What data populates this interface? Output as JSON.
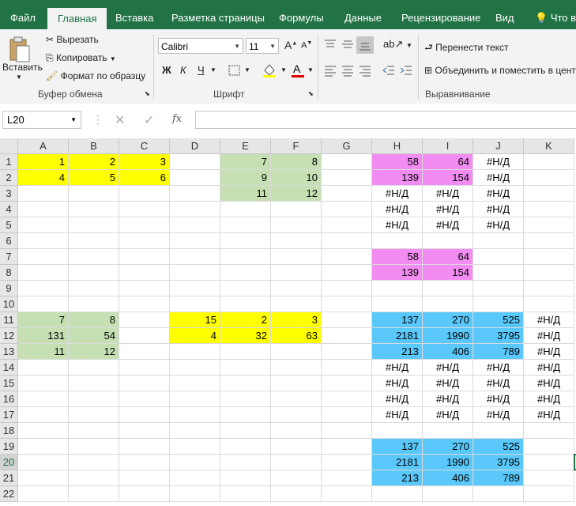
{
  "tabs": [
    "Файл",
    "Главная",
    "Вставка",
    "Разметка страницы",
    "Формулы",
    "Данные",
    "Рецензирование",
    "Вид",
    "Что вы"
  ],
  "ribbon": {
    "paste": "Вставить",
    "cut": "Вырезать",
    "copy": "Копировать",
    "format_painter": "Формат по образцу",
    "clipboard_group": "Буфер обмена",
    "font_name": "Calibri",
    "font_size": "11",
    "bold": "Ж",
    "italic": "К",
    "underline": "Ч",
    "font_group": "Шрифт",
    "wrap_text": "Перенести текст",
    "merge": "Объединить и поместить в центре",
    "align_group": "Выравнивание"
  },
  "formula_bar": {
    "name_box": "L20",
    "fx": "fx",
    "value": ""
  },
  "columns": [
    "A",
    "B",
    "C",
    "D",
    "E",
    "F",
    "G",
    "H",
    "I",
    "J",
    "K"
  ],
  "rows": [
    "1",
    "2",
    "3",
    "4",
    "5",
    "6",
    "7",
    "8",
    "9",
    "10",
    "11",
    "12",
    "13",
    "14",
    "15",
    "16",
    "17",
    "18",
    "19",
    "20",
    "21",
    "22"
  ],
  "cells": [
    {
      "c": "A",
      "r": 1,
      "v": "1",
      "f": "y"
    },
    {
      "c": "B",
      "r": 1,
      "v": "2",
      "f": "y"
    },
    {
      "c": "C",
      "r": 1,
      "v": "3",
      "f": "y"
    },
    {
      "c": "A",
      "r": 2,
      "v": "4",
      "f": "y"
    },
    {
      "c": "B",
      "r": 2,
      "v": "5",
      "f": "y"
    },
    {
      "c": "C",
      "r": 2,
      "v": "6",
      "f": "y"
    },
    {
      "c": "E",
      "r": 1,
      "v": "7",
      "f": "g"
    },
    {
      "c": "F",
      "r": 1,
      "v": "8",
      "f": "g"
    },
    {
      "c": "E",
      "r": 2,
      "v": "9",
      "f": "g"
    },
    {
      "c": "F",
      "r": 2,
      "v": "10",
      "f": "g"
    },
    {
      "c": "E",
      "r": 3,
      "v": "11",
      "f": "g"
    },
    {
      "c": "F",
      "r": 3,
      "v": "12",
      "f": "g"
    },
    {
      "c": "H",
      "r": 1,
      "v": "58",
      "f": "p"
    },
    {
      "c": "I",
      "r": 1,
      "v": "64",
      "f": "p"
    },
    {
      "c": "J",
      "r": 1,
      "v": "#Н/Д",
      "a": "ctr"
    },
    {
      "c": "H",
      "r": 2,
      "v": "139",
      "f": "p"
    },
    {
      "c": "I",
      "r": 2,
      "v": "154",
      "f": "p"
    },
    {
      "c": "J",
      "r": 2,
      "v": "#Н/Д",
      "a": "ctr"
    },
    {
      "c": "H",
      "r": 3,
      "v": "#Н/Д",
      "a": "ctr"
    },
    {
      "c": "I",
      "r": 3,
      "v": "#Н/Д",
      "a": "ctr"
    },
    {
      "c": "J",
      "r": 3,
      "v": "#Н/Д",
      "a": "ctr"
    },
    {
      "c": "H",
      "r": 4,
      "v": "#Н/Д",
      "a": "ctr"
    },
    {
      "c": "I",
      "r": 4,
      "v": "#Н/Д",
      "a": "ctr"
    },
    {
      "c": "J",
      "r": 4,
      "v": "#Н/Д",
      "a": "ctr"
    },
    {
      "c": "H",
      "r": 5,
      "v": "#Н/Д",
      "a": "ctr"
    },
    {
      "c": "I",
      "r": 5,
      "v": "#Н/Д",
      "a": "ctr"
    },
    {
      "c": "J",
      "r": 5,
      "v": "#Н/Д",
      "a": "ctr"
    },
    {
      "c": "H",
      "r": 7,
      "v": "58",
      "f": "p"
    },
    {
      "c": "I",
      "r": 7,
      "v": "64",
      "f": "p"
    },
    {
      "c": "H",
      "r": 8,
      "v": "139",
      "f": "p"
    },
    {
      "c": "I",
      "r": 8,
      "v": "154",
      "f": "p"
    },
    {
      "c": "A",
      "r": 11,
      "v": "7",
      "f": "g"
    },
    {
      "c": "B",
      "r": 11,
      "v": "8",
      "f": "g"
    },
    {
      "c": "A",
      "r": 12,
      "v": "131",
      "f": "g"
    },
    {
      "c": "B",
      "r": 12,
      "v": "54",
      "f": "g"
    },
    {
      "c": "A",
      "r": 13,
      "v": "11",
      "f": "g"
    },
    {
      "c": "B",
      "r": 13,
      "v": "12",
      "f": "g"
    },
    {
      "c": "D",
      "r": 11,
      "v": "15",
      "f": "y"
    },
    {
      "c": "E",
      "r": 11,
      "v": "2",
      "f": "y"
    },
    {
      "c": "F",
      "r": 11,
      "v": "3",
      "f": "y"
    },
    {
      "c": "D",
      "r": 12,
      "v": "4",
      "f": "y"
    },
    {
      "c": "E",
      "r": 12,
      "v": "32",
      "f": "y"
    },
    {
      "c": "F",
      "r": 12,
      "v": "63",
      "f": "y"
    },
    {
      "c": "H",
      "r": 11,
      "v": "137",
      "f": "b"
    },
    {
      "c": "I",
      "r": 11,
      "v": "270",
      "f": "b"
    },
    {
      "c": "J",
      "r": 11,
      "v": "525",
      "f": "b"
    },
    {
      "c": "K",
      "r": 11,
      "v": "#Н/Д",
      "a": "ctr"
    },
    {
      "c": "H",
      "r": 12,
      "v": "2181",
      "f": "b"
    },
    {
      "c": "I",
      "r": 12,
      "v": "1990",
      "f": "b"
    },
    {
      "c": "J",
      "r": 12,
      "v": "3795",
      "f": "b"
    },
    {
      "c": "K",
      "r": 12,
      "v": "#Н/Д",
      "a": "ctr"
    },
    {
      "c": "H",
      "r": 13,
      "v": "213",
      "f": "b"
    },
    {
      "c": "I",
      "r": 13,
      "v": "406",
      "f": "b"
    },
    {
      "c": "J",
      "r": 13,
      "v": "789",
      "f": "b"
    },
    {
      "c": "K",
      "r": 13,
      "v": "#Н/Д",
      "a": "ctr"
    },
    {
      "c": "H",
      "r": 14,
      "v": "#Н/Д",
      "a": "ctr"
    },
    {
      "c": "I",
      "r": 14,
      "v": "#Н/Д",
      "a": "ctr"
    },
    {
      "c": "J",
      "r": 14,
      "v": "#Н/Д",
      "a": "ctr"
    },
    {
      "c": "K",
      "r": 14,
      "v": "#Н/Д",
      "a": "ctr"
    },
    {
      "c": "H",
      "r": 15,
      "v": "#Н/Д",
      "a": "ctr"
    },
    {
      "c": "I",
      "r": 15,
      "v": "#Н/Д",
      "a": "ctr"
    },
    {
      "c": "J",
      "r": 15,
      "v": "#Н/Д",
      "a": "ctr"
    },
    {
      "c": "K",
      "r": 15,
      "v": "#Н/Д",
      "a": "ctr"
    },
    {
      "c": "H",
      "r": 16,
      "v": "#Н/Д",
      "a": "ctr"
    },
    {
      "c": "I",
      "r": 16,
      "v": "#Н/Д",
      "a": "ctr"
    },
    {
      "c": "J",
      "r": 16,
      "v": "#Н/Д",
      "a": "ctr"
    },
    {
      "c": "K",
      "r": 16,
      "v": "#Н/Д",
      "a": "ctr"
    },
    {
      "c": "H",
      "r": 17,
      "v": "#Н/Д",
      "a": "ctr"
    },
    {
      "c": "I",
      "r": 17,
      "v": "#Н/Д",
      "a": "ctr"
    },
    {
      "c": "J",
      "r": 17,
      "v": "#Н/Д",
      "a": "ctr"
    },
    {
      "c": "K",
      "r": 17,
      "v": "#Н/Д",
      "a": "ctr"
    },
    {
      "c": "H",
      "r": 19,
      "v": "137",
      "f": "b"
    },
    {
      "c": "I",
      "r": 19,
      "v": "270",
      "f": "b"
    },
    {
      "c": "J",
      "r": 19,
      "v": "525",
      "f": "b"
    },
    {
      "c": "H",
      "r": 20,
      "v": "2181",
      "f": "b"
    },
    {
      "c": "I",
      "r": 20,
      "v": "1990",
      "f": "b"
    },
    {
      "c": "J",
      "r": 20,
      "v": "3795",
      "f": "b"
    },
    {
      "c": "H",
      "r": 21,
      "v": "213",
      "f": "b"
    },
    {
      "c": "I",
      "r": 21,
      "v": "406",
      "f": "b"
    },
    {
      "c": "J",
      "r": 21,
      "v": "789",
      "f": "b"
    }
  ],
  "colors": {
    "excel_green": "#217346",
    "yellow": "#ffff00",
    "green": "#c6e0b4",
    "pink": "#f28cf2",
    "blue": "#5ac8fa"
  }
}
